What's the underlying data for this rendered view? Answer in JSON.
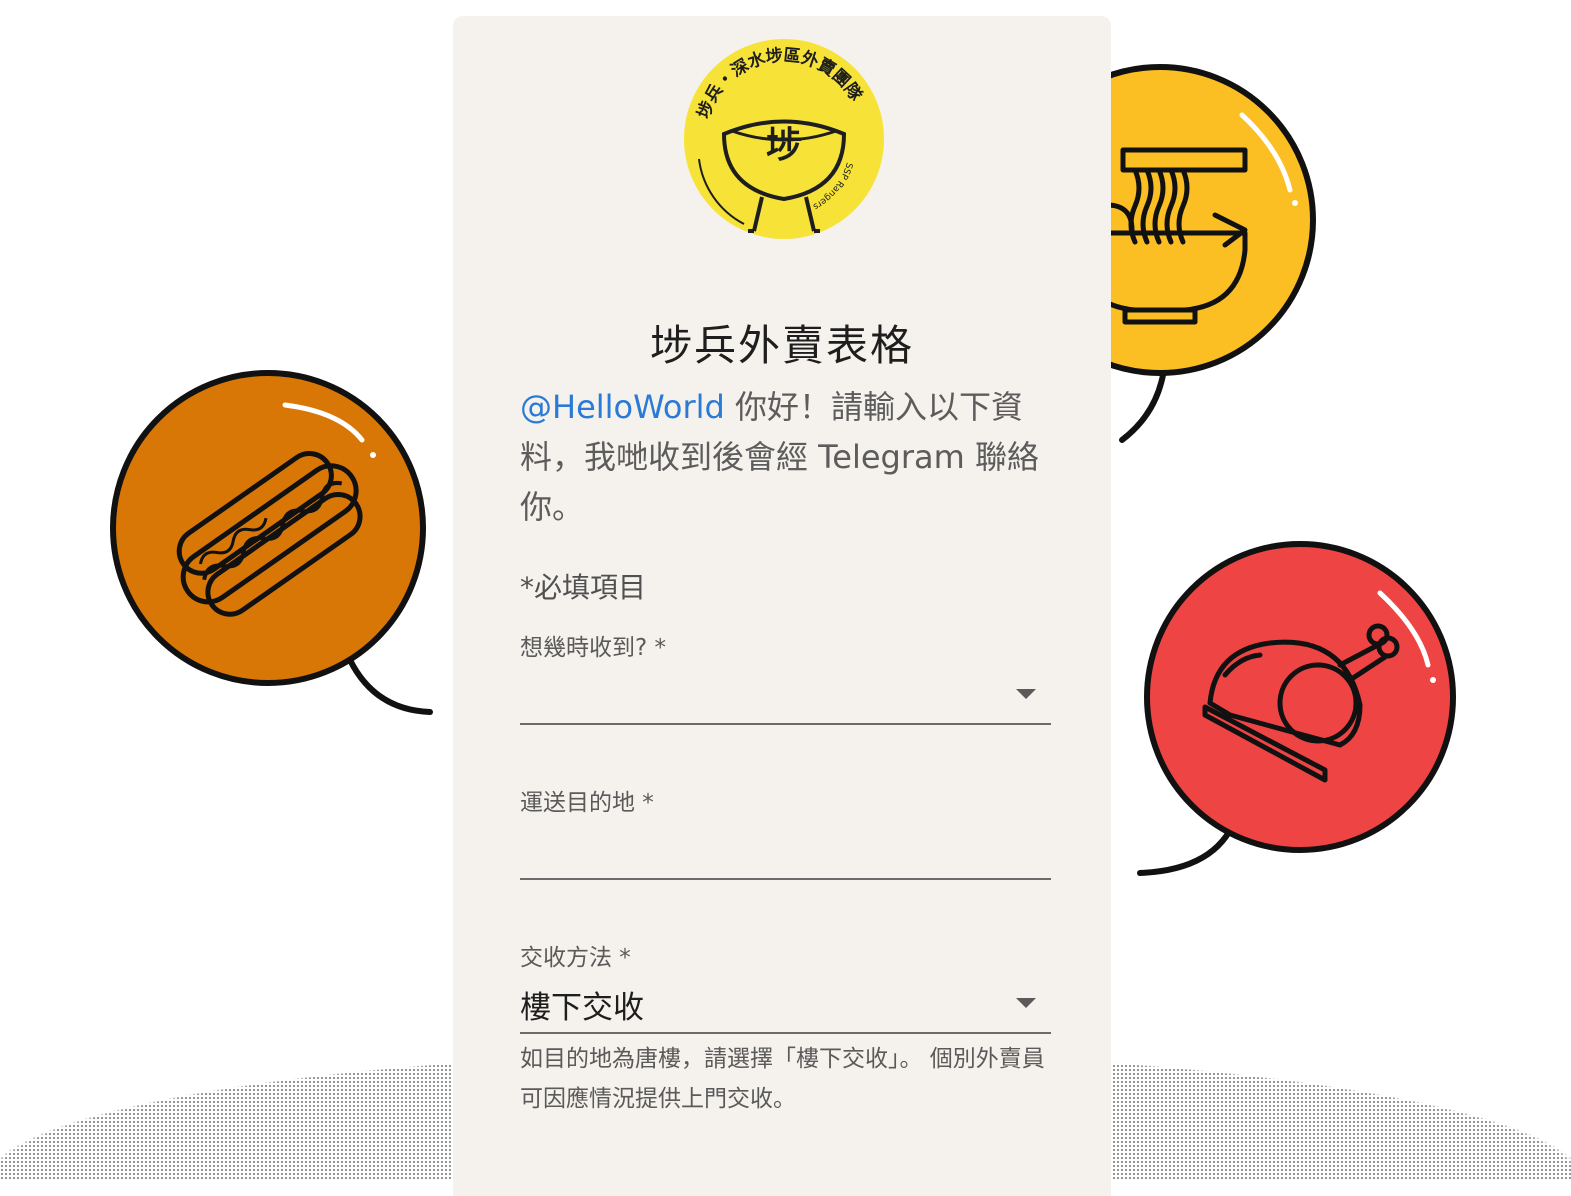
{
  "logo": {
    "ring_text": "埗兵・深水埗區外賣團隊",
    "sub_text": "SSP Rangers",
    "center_char": "埗"
  },
  "form": {
    "title": "埗兵外賣表格",
    "greeting_handle": "@HelloWorld",
    "greeting_text": " 你好！請輸入以下資料，我哋收到後會經 Telegram 聯絡你。",
    "required_note": "*必填項目",
    "fields": [
      {
        "label": "想幾時收到? *",
        "value": "",
        "type": "select"
      },
      {
        "label": "運送目的地 *",
        "value": "",
        "type": "text"
      },
      {
        "label": "交收方法 *",
        "value": "樓下交收",
        "type": "select",
        "helper": "如目的地為唐樓，請選擇「樓下交收」。 個別外賣員可因應情況提供上門交收。"
      }
    ]
  },
  "decorations": {
    "bubbles": [
      {
        "name": "hotdog-icon",
        "color": "#d97706"
      },
      {
        "name": "noodle-bowl-icon",
        "color": "#fbbf24"
      },
      {
        "name": "roast-chicken-icon",
        "color": "#ef4444"
      }
    ]
  },
  "colors": {
    "card_bg": "#f5f1ec",
    "link": "#2a7ad8",
    "logo_yellow": "#f7e337"
  }
}
